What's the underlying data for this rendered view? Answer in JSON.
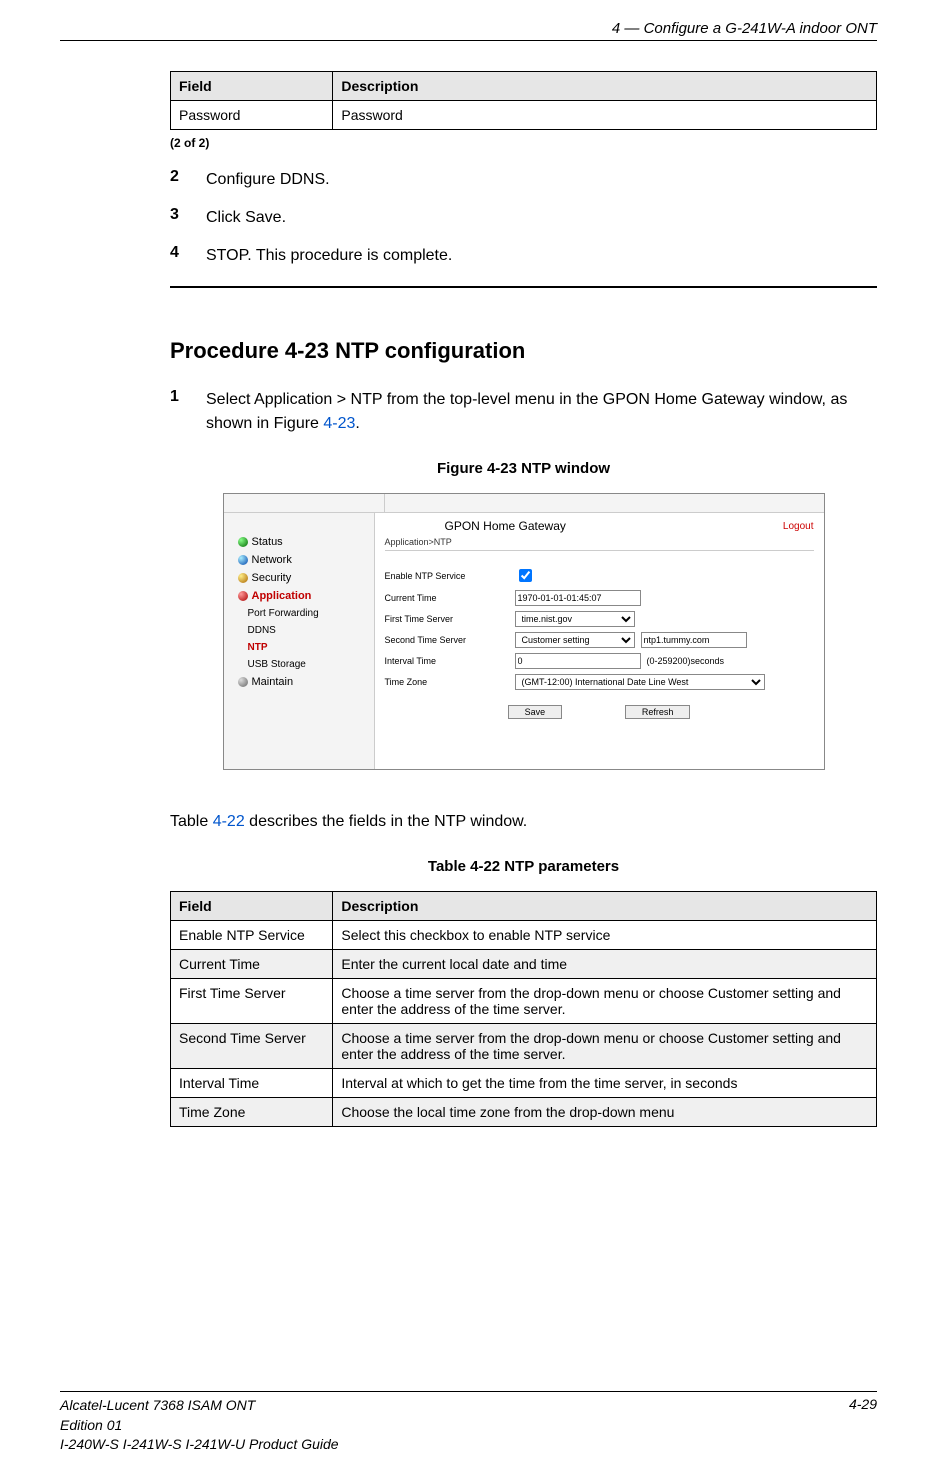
{
  "header": {
    "running_title": "4 —  Configure a G-241W-A indoor ONT"
  },
  "top_table": {
    "cols": [
      "Field",
      "Description"
    ],
    "rows": [
      {
        "field": "Password",
        "desc": "Password"
      }
    ],
    "note": "(2 of 2)"
  },
  "steps_top": [
    {
      "num": "2",
      "text": "Configure DDNS."
    },
    {
      "num": "3",
      "text": "Click Save."
    },
    {
      "num": "4",
      "text": "STOP. This procedure is complete."
    }
  ],
  "procedure_heading": "Procedure 4-23  NTP configuration",
  "step1": {
    "num": "1",
    "pre": "Select Application > NTP from the top-level menu in the GPON Home Gateway window, as shown in Figure ",
    "link": "4-23",
    "post": "."
  },
  "figure_caption": "Figure 4-23  NTP window",
  "figure_ui": {
    "title": "GPON Home Gateway",
    "logout": "Logout",
    "breadcrumb": "Application>NTP",
    "sidebar": [
      {
        "label": "Status",
        "icon": "green"
      },
      {
        "label": "Network",
        "icon": "blue"
      },
      {
        "label": "Security",
        "icon": "gold"
      },
      {
        "label": "Application",
        "icon": "red",
        "active": true
      },
      {
        "label": "Port Forwarding",
        "sub": true
      },
      {
        "label": "DDNS",
        "sub": true
      },
      {
        "label": "NTP",
        "sub": true,
        "selected": true
      },
      {
        "label": "USB Storage",
        "sub": true
      },
      {
        "label": "Maintain",
        "icon": "grey"
      }
    ],
    "form": {
      "enable_label": "Enable NTP Service",
      "enable_checked": true,
      "current_time_label": "Current Time",
      "current_time_value": "1970-01-01-01:45:07",
      "first_server_label": "First Time Server",
      "first_server_value": "time.nist.gov",
      "second_server_label": "Second Time Server",
      "second_server_value": "Customer setting",
      "second_server_input": "ntp1.tummy.com",
      "interval_label": "Interval Time",
      "interval_value": "0",
      "interval_hint": "(0-259200)seconds",
      "timezone_label": "Time Zone",
      "timezone_value": "(GMT-12:00) International Date Line West"
    },
    "buttons": {
      "save": "Save",
      "refresh": "Refresh"
    }
  },
  "pre_table_text": {
    "pre": "Table ",
    "link": "4-22",
    "post": " describes the fields in the NTP window."
  },
  "table_caption": "Table 4-22 NTP parameters",
  "ntp_table": {
    "cols": [
      "Field",
      "Description"
    ],
    "rows": [
      {
        "field": "Enable NTP Service",
        "desc": "Select this checkbox to enable NTP service",
        "alt": false
      },
      {
        "field": "Current Time",
        "desc": "Enter the current local date and time",
        "alt": true
      },
      {
        "field": "First Time Server",
        "desc": "Choose a time server from the drop-down menu or choose Customer setting and enter the address of the time server.",
        "alt": false
      },
      {
        "field": "Second Time Server",
        "desc": "Choose a time server from the drop-down menu or choose Customer setting and enter the address of the time server.",
        "alt": true
      },
      {
        "field": "Interval Time",
        "desc": "Interval at which to get the time from the time server, in seconds",
        "alt": false
      },
      {
        "field": "Time Zone",
        "desc": "Choose the local time zone from the drop-down menu",
        "alt": true
      }
    ]
  },
  "footer": {
    "line1": "Alcatel-Lucent 7368 ISAM ONT",
    "line2": "Edition 01",
    "line3": "I-240W-S I-241W-S I-241W-U Product Guide",
    "page": "4-29"
  }
}
